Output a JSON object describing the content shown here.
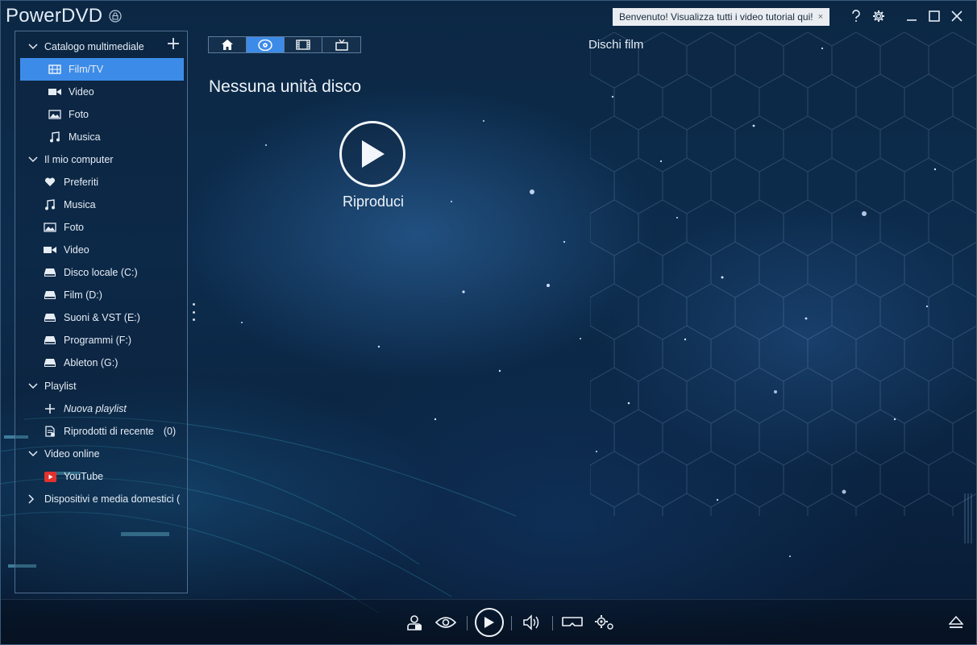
{
  "app": {
    "title": "PowerDVD",
    "welcome_banner": "Benvenuto! Visualizza tutti i video tutorial qui!",
    "welcome_close": "×"
  },
  "sidebar": {
    "sections": [
      {
        "label": "Catalogo multimediale",
        "expanded": true,
        "items": [
          {
            "label": "Film/TV",
            "icon": "film-tv-icon",
            "selected": true
          },
          {
            "label": "Video",
            "icon": "video-camera-icon"
          },
          {
            "label": "Foto",
            "icon": "photo-icon"
          },
          {
            "label": "Musica",
            "icon": "music-note-icon"
          }
        ]
      },
      {
        "label": "Il mio computer",
        "expanded": true,
        "items": [
          {
            "label": "Preferiti",
            "icon": "heart-icon"
          },
          {
            "label": "Musica",
            "icon": "music-note-icon"
          },
          {
            "label": "Foto",
            "icon": "photo-icon"
          },
          {
            "label": "Video",
            "icon": "video-camera-icon"
          },
          {
            "label": "Disco locale (C:)",
            "icon": "drive-icon"
          },
          {
            "label": "Film (D:)",
            "icon": "drive-icon"
          },
          {
            "label": "Suoni & VST (E:)",
            "icon": "drive-icon"
          },
          {
            "label": "Programmi (F:)",
            "icon": "drive-icon"
          },
          {
            "label": "Ableton (G:)",
            "icon": "drive-icon"
          }
        ]
      },
      {
        "label": "Playlist",
        "expanded": true,
        "items": [
          {
            "label": "Nuova playlist",
            "icon": "plus-icon"
          },
          {
            "label": "Riprodotti di recente",
            "icon": "recent-list-icon",
            "count": "(0)"
          }
        ]
      },
      {
        "label": "Video online",
        "expanded": true,
        "items": [
          {
            "label": "YouTube",
            "icon": "youtube-icon"
          }
        ]
      },
      {
        "label": "Dispositivi e media domestici (",
        "expanded": false,
        "items": []
      }
    ]
  },
  "tabs": [
    {
      "name": "home-icon",
      "active": false
    },
    {
      "name": "disc-icon",
      "active": true
    },
    {
      "name": "film-strip-icon",
      "active": false
    },
    {
      "name": "tv-icon",
      "active": false
    }
  ],
  "main": {
    "section_title": "Dischi film",
    "heading": "Nessuna unità disco",
    "play_label": "Riproduci"
  },
  "colors": {
    "accent": "#3d8be8",
    "background": "#0d2c4d"
  }
}
